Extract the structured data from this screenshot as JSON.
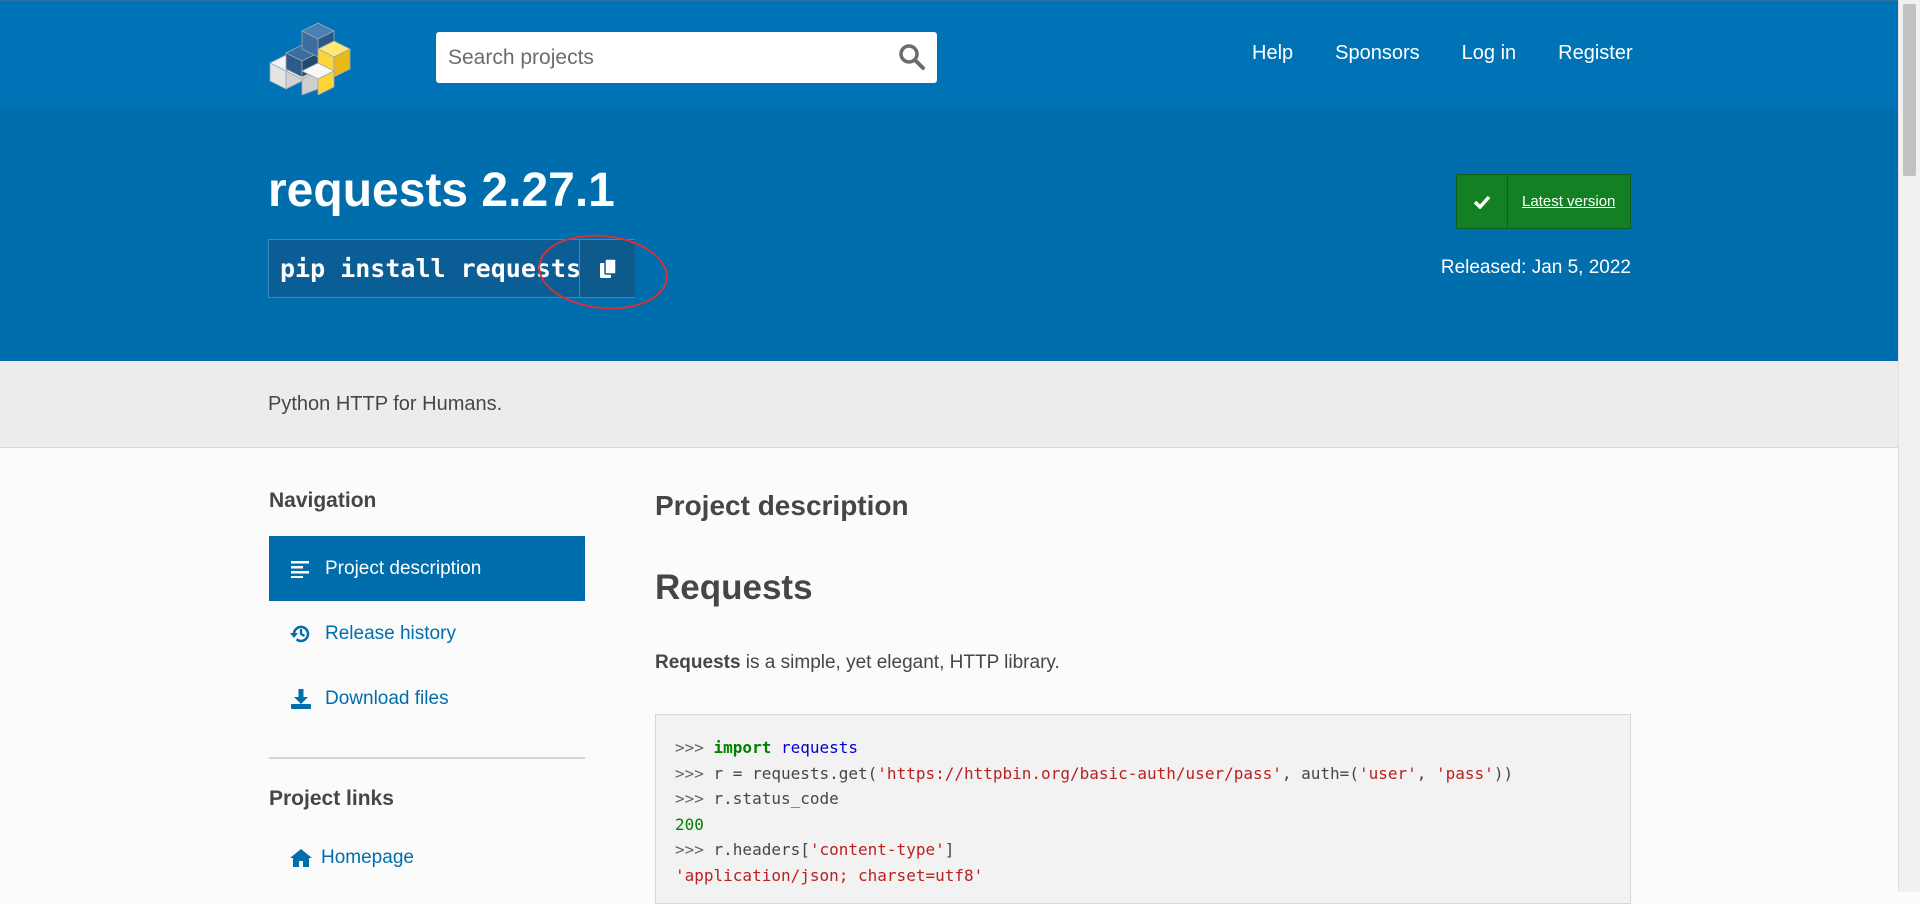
{
  "header": {
    "search_placeholder": "Search projects",
    "nav": [
      "Help",
      "Sponsors",
      "Log in",
      "Register"
    ]
  },
  "project": {
    "title": "requests 2.27.1",
    "pip_command": "pip install requests",
    "latest_label": "Latest version",
    "released": "Released: Jan 5, 2022",
    "summary": "Python HTTP for Humans."
  },
  "sidebar": {
    "navigation_heading": "Navigation",
    "items": [
      {
        "label": "Project description",
        "icon": "align-left-icon",
        "active": true
      },
      {
        "label": "Release history",
        "icon": "history-icon",
        "active": false
      },
      {
        "label": "Download files",
        "icon": "download-icon",
        "active": false
      }
    ],
    "links_heading": "Project links",
    "links": [
      {
        "label": "Homepage",
        "icon": "home-icon"
      }
    ]
  },
  "main": {
    "heading": "Project description",
    "readme_title": "Requests",
    "intro_bold": "Requests",
    "intro_rest": " is a simple, yet elegant, HTTP library.",
    "code_lines": [
      ">>> import requests",
      ">>> r = requests.get('https://httpbin.org/basic-auth/user/pass', auth=('user', 'pass'))",
      ">>> r.status_code",
      "200",
      ">>> r.headers['content-type']",
      "'application/json; charset=utf8'"
    ]
  },
  "colors": {
    "header_blue": "#0073b7",
    "hero_blue": "#006dad",
    "latest_green": "#148024",
    "annotation_red": "#d4323a"
  }
}
